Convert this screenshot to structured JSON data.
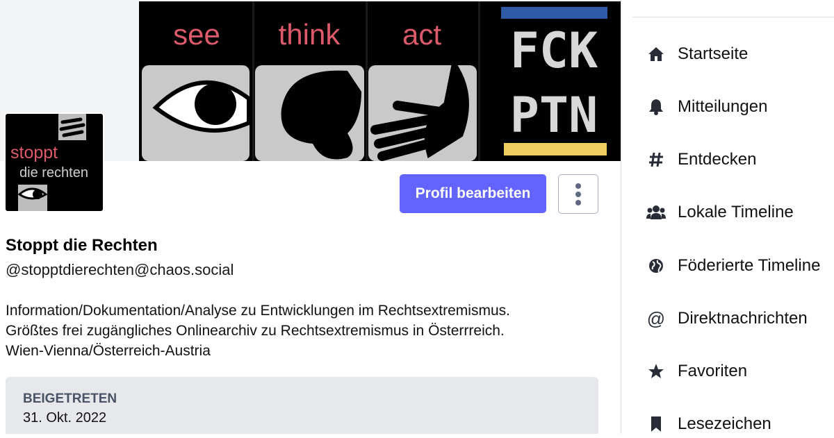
{
  "banner": {
    "words": [
      "see",
      "think",
      "act"
    ],
    "sign_line1": "FCK",
    "sign_line2": "PTN"
  },
  "avatar": {
    "line1": "stoppt",
    "line2": "die rechten"
  },
  "profile": {
    "display_name": "Stoppt die Rechten",
    "handle": "@stopptdierechten@chaos.social",
    "bio_lines": [
      "Information/Dokumentation/Analyse zu Entwicklungen im Rechtsextremismus.",
      "Größtes frei zugängliches Onlinearchiv zu Rechtsextremismus in Österrreich.",
      "Wien-Vienna/Österreich-Austria"
    ],
    "joined_label": "BEIGETRETEN",
    "joined_date": "31. Okt. 2022"
  },
  "actions": {
    "edit_label": "Profil bearbeiten"
  },
  "nav": {
    "items": [
      {
        "label": "Startseite",
        "icon": "home-icon"
      },
      {
        "label": "Mitteilungen",
        "icon": "bell-icon"
      },
      {
        "label": "Entdecken",
        "icon": "hashtag-icon"
      },
      {
        "label": "Lokale Timeline",
        "icon": "users-icon"
      },
      {
        "label": "Föderierte Timeline",
        "icon": "globe-icon"
      },
      {
        "label": "Direktnachrichten",
        "icon": "at-icon"
      },
      {
        "label": "Favoriten",
        "icon": "star-icon"
      },
      {
        "label": "Lesezeichen",
        "icon": "bookmark-icon"
      }
    ]
  },
  "colors": {
    "accent": "#6364ff",
    "banner_text": "#dd5a6a",
    "flag_blue": "#2e5aa8",
    "flag_yellow": "#f0cd60"
  }
}
